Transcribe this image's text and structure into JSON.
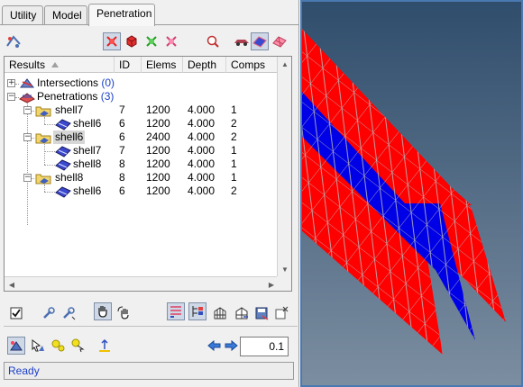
{
  "tabs": [
    {
      "label": "Utility"
    },
    {
      "label": "Model"
    },
    {
      "label": "Penetration"
    }
  ],
  "active_tab": "Penetration",
  "table": {
    "headers": {
      "results": "Results",
      "id": "ID",
      "elems": "Elems",
      "depth": "Depth",
      "comps": "Comps"
    },
    "intersections": {
      "label": "Intersections",
      "count": "(0)"
    },
    "penetrations": {
      "label": "Penetrations",
      "count": "(3)"
    },
    "rows": [
      {
        "name": "shell7",
        "id": "7",
        "elems": "1200",
        "depth": "4.000",
        "comps": "1"
      },
      {
        "name": "shell6",
        "id": "6",
        "elems": "1200",
        "depth": "4.000",
        "comps": "2"
      },
      {
        "name": "shell6",
        "id": "6",
        "elems": "2400",
        "depth": "4.000",
        "comps": "2"
      },
      {
        "name": "shell7",
        "id": "7",
        "elems": "1200",
        "depth": "4.000",
        "comps": "1"
      },
      {
        "name": "shell8",
        "id": "8",
        "elems": "1200",
        "depth": "4.000",
        "comps": "1"
      },
      {
        "name": "shell8",
        "id": "8",
        "elems": "1200",
        "depth": "4.000",
        "comps": "1"
      },
      {
        "name": "shell6",
        "id": "6",
        "elems": "1200",
        "depth": "4.000",
        "comps": "2"
      }
    ]
  },
  "step_value": "0.1",
  "status": "Ready",
  "colors": {
    "red_shell": "#ff0000",
    "blue_shell": "#0000e6",
    "mesh_line": "#b8b8b8",
    "bg_top": "#2f4d6c",
    "bg_bottom": "#7c8ea1"
  },
  "icons": [
    "penetration-check-icon",
    "red-node-icon",
    "red-cube-icon",
    "green-node-icon",
    "pink-node-icon",
    "find-icon",
    "car-icon",
    "blue-shell-icon",
    "pink-shell-icon",
    "checkbox-icon",
    "wrench-icon",
    "wrench-icon",
    "hand-icon",
    "rotate-hand-icon",
    "list-icon",
    "tree-icon",
    "mesh-icon",
    "mesh-arrows-icon",
    "save-icon",
    "close-icon",
    "node-icon",
    "arrow-node-icon",
    "yellow-ball-icon",
    "yellow-ball-arrow-icon",
    "move-icon",
    "left-arrow-icon",
    "right-arrow-icon"
  ]
}
